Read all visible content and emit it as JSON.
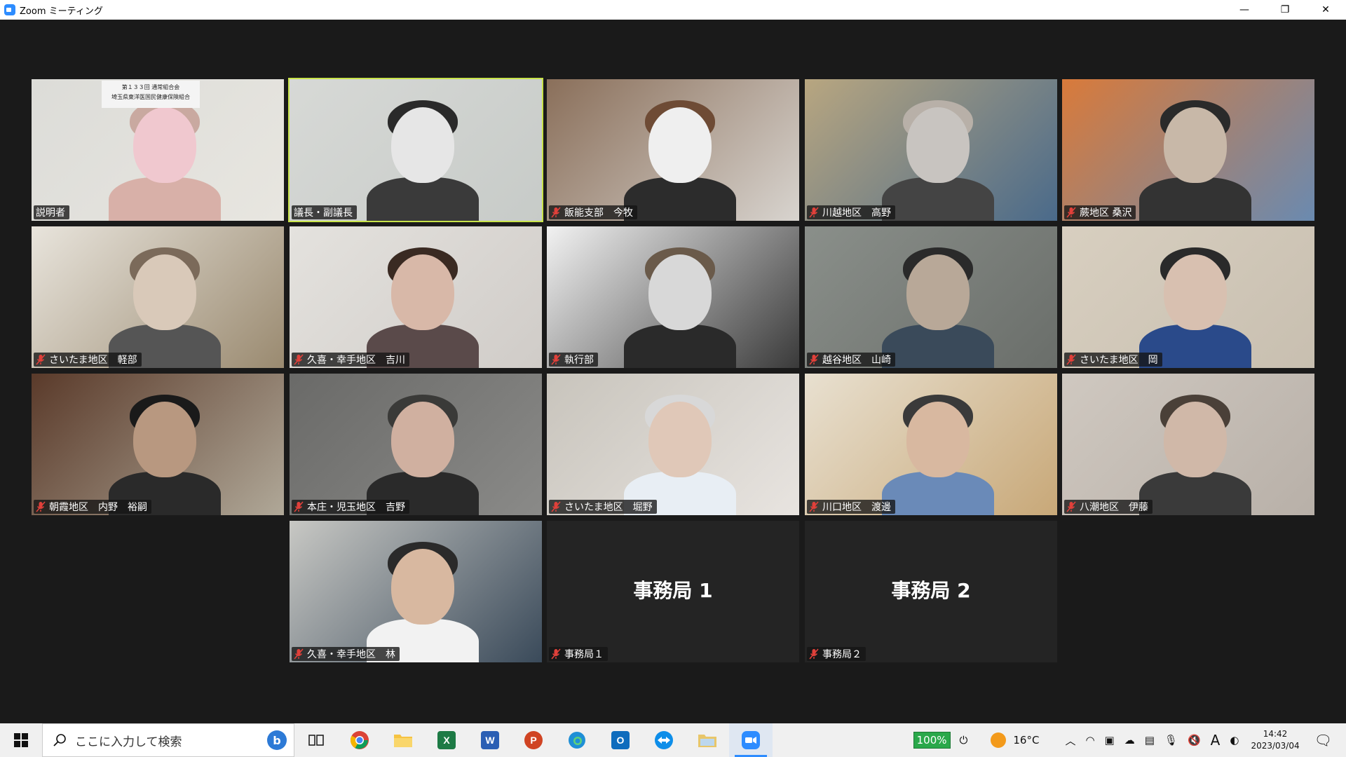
{
  "window": {
    "title": "Zoom ミーティング",
    "controls": {
      "minimize": "—",
      "restore": "❐",
      "close": "✕"
    }
  },
  "colors": {
    "active_speaker_border": "#c8e34a",
    "muted_icon": "#e0403a",
    "zoom_blue": "#2d8cff"
  },
  "participants": [
    {
      "name": "説明者",
      "muted": false,
      "active": false,
      "kind": "video"
    },
    {
      "name": "議長・副議長",
      "muted": false,
      "active": true,
      "kind": "video"
    },
    {
      "name": "飯能支部　今牧",
      "muted": true,
      "active": false,
      "kind": "video"
    },
    {
      "name": "川越地区　高野",
      "muted": true,
      "active": false,
      "kind": "video"
    },
    {
      "name": "蕨地区 桑沢",
      "muted": true,
      "active": false,
      "kind": "video"
    },
    {
      "name": "さいたま地区　軽部",
      "muted": true,
      "active": false,
      "kind": "video"
    },
    {
      "name": "久喜・幸手地区　吉川",
      "muted": true,
      "active": false,
      "kind": "video"
    },
    {
      "name": "執行部",
      "muted": true,
      "active": false,
      "kind": "video"
    },
    {
      "name": "越谷地区　山崎",
      "muted": true,
      "active": false,
      "kind": "video"
    },
    {
      "name": "さいたま地区　岡",
      "muted": true,
      "active": false,
      "kind": "video"
    },
    {
      "name": "朝霞地区　内野　裕嗣",
      "muted": true,
      "active": false,
      "kind": "video"
    },
    {
      "name": "本庄・児玉地区　吉野",
      "muted": true,
      "active": false,
      "kind": "video"
    },
    {
      "name": "さいたま地区　堀野",
      "muted": true,
      "active": false,
      "kind": "video"
    },
    {
      "name": "川口地区　渡邊",
      "muted": true,
      "active": false,
      "kind": "video"
    },
    {
      "name": "八潮地区　伊藤",
      "muted": true,
      "active": false,
      "kind": "video"
    },
    {
      "name": "久喜・幸手地区　林",
      "muted": true,
      "active": false,
      "kind": "video"
    },
    {
      "name": "事務局１",
      "muted": true,
      "active": false,
      "kind": "no-video",
      "display_name": "事務局 1"
    },
    {
      "name": "事務局２",
      "muted": true,
      "active": false,
      "kind": "no-video",
      "display_name": "事務局 2"
    }
  ],
  "background_sign": {
    "line1": "第１３３回 通常組合会",
    "line2": "埼玉県東洋医国民健康保険組合"
  },
  "taskbar": {
    "search_placeholder": "ここに入力して検索",
    "apps": [
      "task-view",
      "chrome",
      "file-explorer",
      "excel",
      "word",
      "powerpoint",
      "edge",
      "outlook",
      "teamviewer",
      "folder",
      "zoom"
    ],
    "battery_percent": "100%",
    "temperature": "16°C",
    "ime_indicator": "A",
    "time": "14:42",
    "date": "2023/03/04"
  }
}
